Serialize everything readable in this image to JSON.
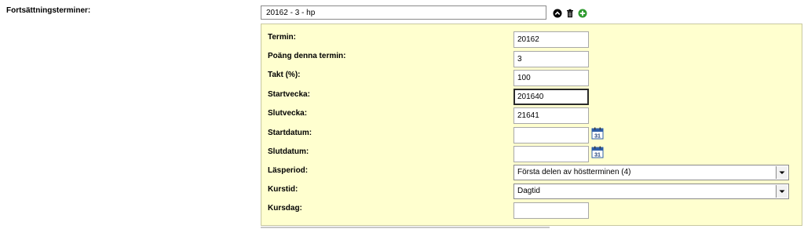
{
  "form": {
    "continuation_label": "Fortsättningsterminer:",
    "summary_value": "20162 - 3 - hp"
  },
  "panel": {
    "fields": [
      {
        "label": "Termin:",
        "value": "20162"
      },
      {
        "label": "Poäng denna termin:",
        "value": "3"
      },
      {
        "label": "Takt (%):",
        "value": "100"
      },
      {
        "label": "Startvecka:",
        "value": "201640"
      },
      {
        "label": "Slutvecka:",
        "value": "21641"
      },
      {
        "label": "Startdatum:",
        "value": ""
      },
      {
        "label": "Slutdatum:",
        "value": ""
      },
      {
        "label": "Läsperiod:",
        "value": "Första delen av höstterminen (4)"
      },
      {
        "label": "Kurstid:",
        "value": "Dagtid"
      },
      {
        "label": "Kursdag:",
        "value": ""
      }
    ],
    "calendar_icon_text": "31"
  },
  "icons": {
    "collapse": "chevron-up-circle-icon",
    "delete": "trash-icon",
    "add": "plus-circle-icon",
    "calendar": "calendar-icon"
  },
  "colors": {
    "panel_bg": "#ffffcf",
    "add_green": "#2e9a2e",
    "calendar_blue": "#2f5fa8"
  }
}
